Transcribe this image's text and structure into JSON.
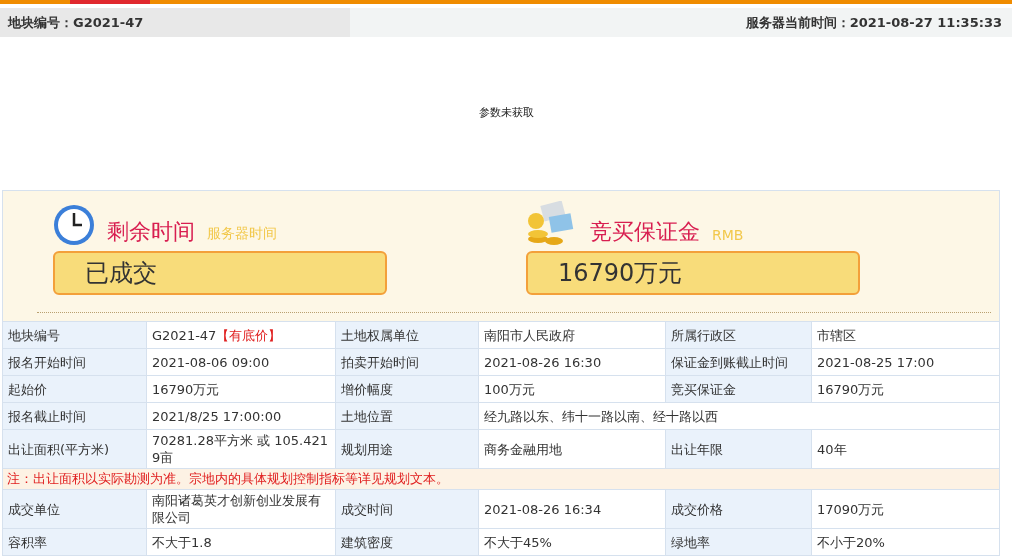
{
  "header": {
    "plot_label": "地块编号：G2021-47",
    "server_time": "服务器当前时间：2021-08-27 11:35:33"
  },
  "message": "参数未获取",
  "panels": [
    {
      "kind": "clock",
      "title": "剩余时间",
      "subtitle": "服务器时间",
      "value": "已成交"
    },
    {
      "kind": "money",
      "title": "竞买保证金",
      "subtitle": "RMB",
      "value": "16790万元"
    }
  ],
  "rows": [
    {
      "kind": "cells",
      "cells": [
        {
          "kind": "label",
          "text": "地块编号"
        },
        {
          "kind": "value",
          "text": "G2021-47",
          "tag": "【有底价】"
        },
        {
          "kind": "label",
          "text": "土地权属单位"
        },
        {
          "kind": "value",
          "text": "南阳市人民政府"
        },
        {
          "kind": "label",
          "text": "所属行政区"
        },
        {
          "kind": "value",
          "text": "市辖区"
        }
      ]
    },
    {
      "kind": "cells",
      "cells": [
        {
          "kind": "label",
          "text": "报名开始时间"
        },
        {
          "kind": "value",
          "text": "2021-08-06 09:00"
        },
        {
          "kind": "label",
          "text": "拍卖开始时间"
        },
        {
          "kind": "value",
          "text": "2021-08-26 16:30"
        },
        {
          "kind": "label",
          "text": "保证金到账截止时间"
        },
        {
          "kind": "value",
          "text": "2021-08-25 17:00"
        }
      ]
    },
    {
      "kind": "cells",
      "cells": [
        {
          "kind": "label",
          "text": "起始价"
        },
        {
          "kind": "value",
          "text": "16790万元"
        },
        {
          "kind": "label",
          "text": "增价幅度"
        },
        {
          "kind": "value",
          "text": "100万元"
        },
        {
          "kind": "label",
          "text": "竞买保证金"
        },
        {
          "kind": "value",
          "text": "16790万元"
        }
      ]
    },
    {
      "kind": "cells",
      "cells": [
        {
          "kind": "label",
          "text": "报名截止时间"
        },
        {
          "kind": "value",
          "text": "2021/8/25 17:00:00"
        },
        {
          "kind": "label",
          "text": "土地位置"
        },
        {
          "kind": "value",
          "text": "经九路以东、纬十一路以南、经十路以西",
          "wide": true
        }
      ]
    },
    {
      "kind": "cells",
      "cells": [
        {
          "kind": "label",
          "text": "出让面积(平方米)"
        },
        {
          "kind": "value",
          "text": "70281.28平方米 或  105.4219亩"
        },
        {
          "kind": "label",
          "text": "规划用途"
        },
        {
          "kind": "value",
          "text": "商务金融用地"
        },
        {
          "kind": "label",
          "text": "出让年限"
        },
        {
          "kind": "value",
          "text": "40年"
        }
      ]
    },
    {
      "kind": "note",
      "text": "注：出让面积以实际勘测为准。宗地内的具体规划控制指标等详见规划文本。"
    },
    {
      "kind": "cells",
      "cells": [
        {
          "kind": "label",
          "text": "成交单位"
        },
        {
          "kind": "value",
          "text": "南阳诸葛英才创新创业发展有限公司"
        },
        {
          "kind": "label",
          "text": "成交时间"
        },
        {
          "kind": "value",
          "text": "2021-08-26 16:34"
        },
        {
          "kind": "label",
          "text": "成交价格"
        },
        {
          "kind": "value",
          "text": "17090万元"
        }
      ]
    },
    {
      "kind": "cells",
      "cells": [
        {
          "kind": "label",
          "text": "容积率"
        },
        {
          "kind": "value",
          "text": "不大于1.8"
        },
        {
          "kind": "label",
          "text": "建筑密度"
        },
        {
          "kind": "value",
          "text": "不大于45%"
        },
        {
          "kind": "label",
          "text": "绿地率"
        },
        {
          "kind": "value",
          "text": "不小于20%"
        }
      ]
    }
  ]
}
